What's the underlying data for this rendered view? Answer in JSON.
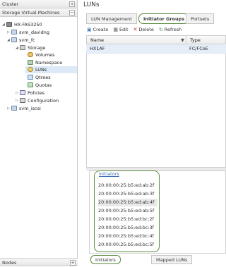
{
  "left": {
    "cluster_label": "Cluster",
    "svm_label": "Storage Virtual Machines",
    "nodes_label": "Nodes",
    "tree": {
      "root": "HX-FAS3250",
      "svm_davidng": "svm_davidng",
      "svm_fc": "svm_fc",
      "storage": "Storage",
      "volumes": "Volumes",
      "namespace": "Namespace",
      "luns": "LUNs",
      "qtrees": "Qtrees",
      "quotas": "Quotas",
      "policies": "Policies",
      "configuration": "Configuration",
      "svm_iscsi": "svm_iscsi"
    }
  },
  "main": {
    "title": "LUNs",
    "tabs": [
      "LUN Management",
      "Initiator Groups",
      "Portsets"
    ],
    "toolbar": {
      "create": "Create",
      "edit": "Edit",
      "delete": "Delete",
      "refresh": "Refresh"
    },
    "grid": {
      "columns": [
        "Name",
        "Type"
      ],
      "rows": [
        {
          "name": "HX1AF",
          "type": "FC/FCoE"
        }
      ]
    },
    "initiators": {
      "label": "Initiators",
      "items": [
        "20:00:00:25:b5:ed:ab:2f",
        "20:00:00:25:b5:ed:ab:3f",
        "20:00:00:25:b5:ed:ab:4f",
        "20:00:00:25:b5:ed:ab:5f",
        "20:00:00:25:b5:ed:bc:2f",
        "20:00:00:25:b5:ed:bc:3f",
        "20:00:00:25:b5:ed:bc:4f",
        "20:00:00:25:b5:ed:bc:5f"
      ]
    },
    "bottom_tabs": [
      "Initiators",
      "Mapped LUNs"
    ]
  },
  "icons": {
    "create": "create-icon",
    "edit": "edit-icon",
    "delete": "delete-icon",
    "refresh": "refresh-icon",
    "filter": "filter-icon"
  },
  "colors": {
    "accent_outline": "#5a8a3c",
    "selection": "#dde9f7",
    "link": "#3a6ab0",
    "delete": "#c0392b",
    "refresh": "#3a8a3a"
  }
}
